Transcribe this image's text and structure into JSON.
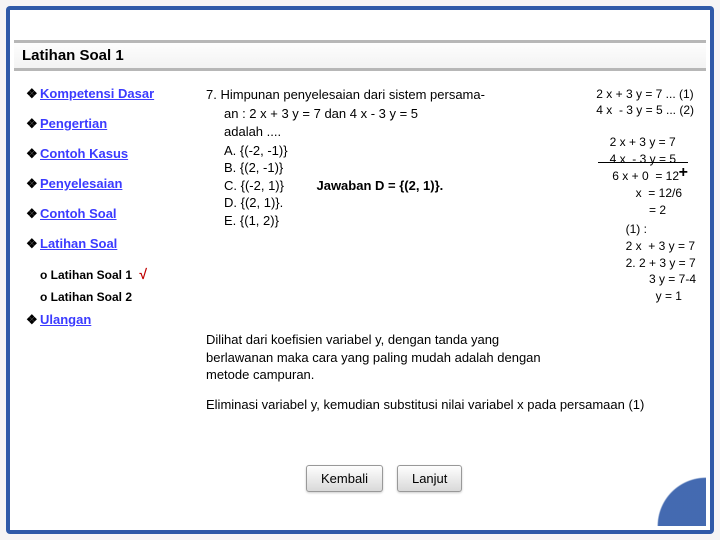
{
  "title": "Latihan Soal 1",
  "sidebar": {
    "items": [
      {
        "label": "Kompetensi Dasar"
      },
      {
        "label": "Pengertian"
      },
      {
        "label": "Contoh Kasus"
      },
      {
        "label": "Penyelesaian"
      },
      {
        "label": "Contoh Soal"
      },
      {
        "label": "Latihan Soal"
      }
    ],
    "subs": [
      {
        "label": "Latihan Soal 1",
        "checked": true
      },
      {
        "label": "Latihan Soal 2",
        "checked": false
      }
    ],
    "last": {
      "label": "Ulangan"
    }
  },
  "question": {
    "num": "7.",
    "line1": "Himpunan penyelesaian dari sistem persama-",
    "line2": "an : 2 x + 3 y = 7 dan 4 x - 3 y = 5",
    "line3": "adalah ....",
    "opts": {
      "A": "A. {(-2, -1)}",
      "B": "B. {(2, -1)}",
      "C": "C. {(-2, 1)}",
      "D": "D. {(2, 1)}.",
      "E": "E. {(1, 2)}"
    },
    "answer": "Jawaban D = {(2, 1)}."
  },
  "topright": "2 x + 3 y = 7 ... (1)\n4 x  - 3 y = 5 ... (2)",
  "calc2": "2 x + 3 y = 7\n4 x  - 3 y = 5",
  "calc3": "6 x + 0  = 12\n       x  = 12/6\n           = 2",
  "calc4": "(1) :\n2 x  + 3 y = 7\n2. 2 + 3 y = 7\n       3 y = 7-4\n         y = 1",
  "para2": "Dilihat dari koefisien variabel y, dengan tanda yang berlawanan maka cara yang paling mudah adalah dengan metode campuran.",
  "para3": "Eliminasi variabel y, kemudian substitusi nilai variabel x pada persamaan (1)",
  "buttons": {
    "back": "Kembali",
    "next": "Lanjut"
  }
}
